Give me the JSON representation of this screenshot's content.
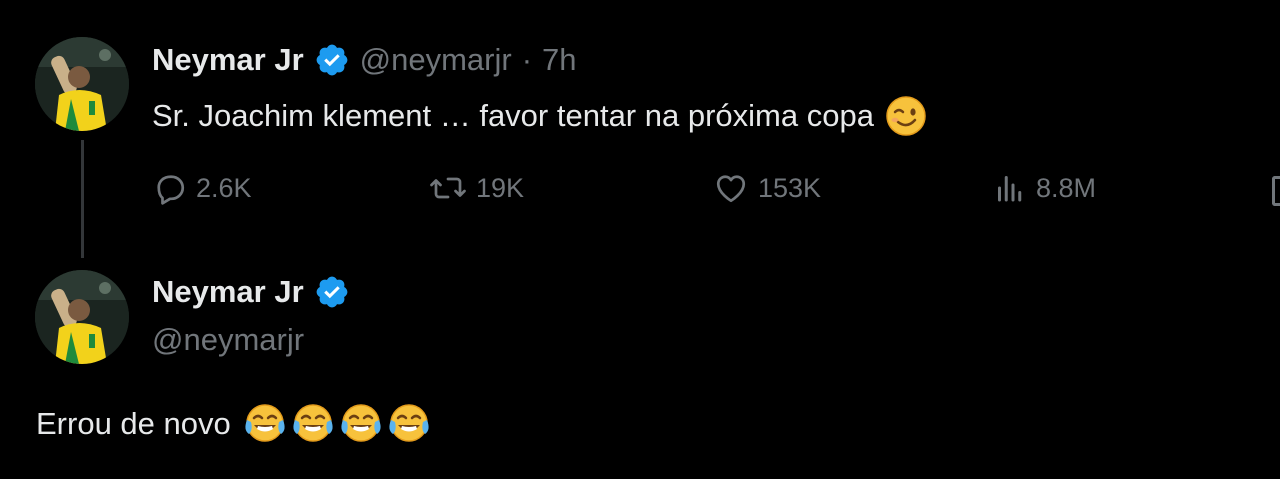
{
  "tweet_1": {
    "display_name": "Neymar Jr",
    "handle": "@neymarjr",
    "time_separator": "·",
    "time": "7h",
    "text": "Sr. Joachim klement … favor tentar na próxima copa",
    "text_emoji": "winking-face",
    "actions": {
      "replies": "2.6K",
      "reposts": "19K",
      "likes": "153K",
      "views": "8.8M"
    }
  },
  "tweet_2": {
    "display_name": "Neymar Jr",
    "handle": "@neymarjr",
    "text": "Errou de novo",
    "text_emojis": [
      "face-with-tears-of-joy",
      "face-with-tears-of-joy",
      "face-with-tears-of-joy",
      "face-with-tears-of-joy"
    ]
  },
  "colors": {
    "background": "#000000",
    "primary_text": "#e7e9ea",
    "secondary_text": "#71767b",
    "verified_blue": "#1d9bf0",
    "thread_line": "#333639"
  }
}
